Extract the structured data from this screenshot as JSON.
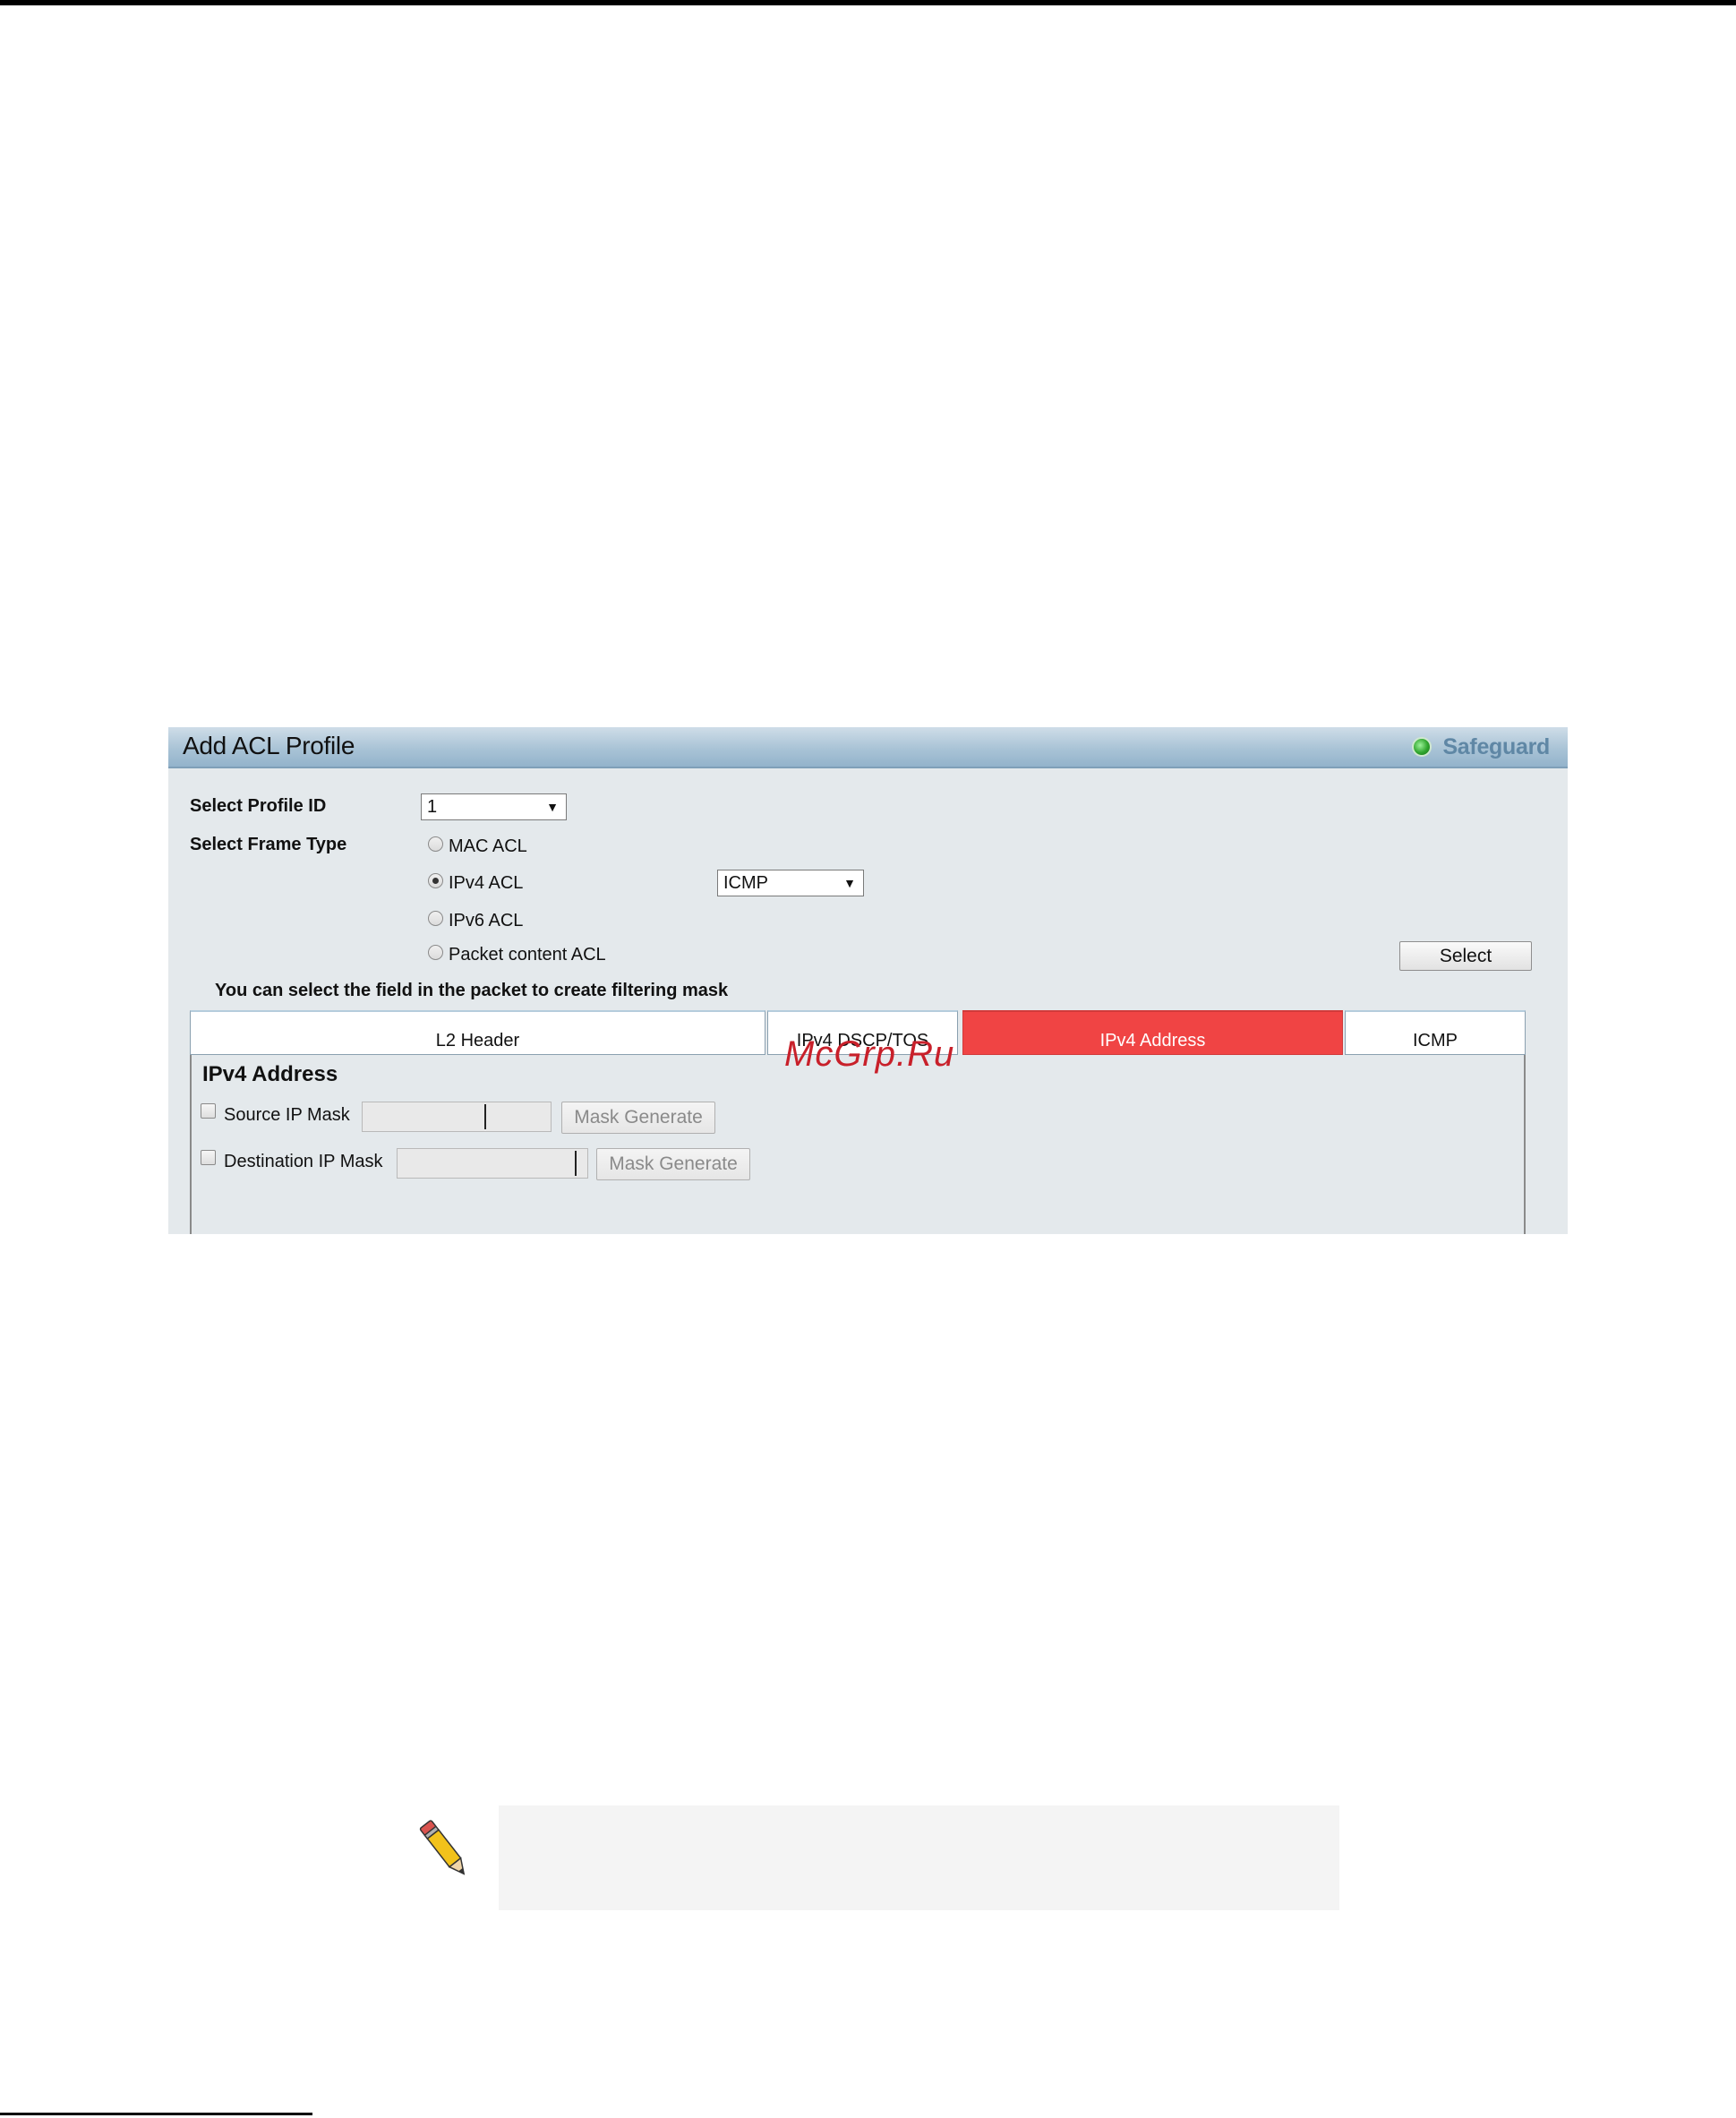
{
  "panel": {
    "title": "Add ACL Profile",
    "safeguard_label": "Safeguard",
    "safeguard_status_color": "#2fa52d"
  },
  "form": {
    "profile_id_label": "Select Profile ID",
    "profile_id_value": "1",
    "frame_type_label": "Select Frame Type",
    "frame_types": [
      {
        "label": "MAC ACL",
        "checked": false
      },
      {
        "label": "IPv4 ACL",
        "checked": true
      },
      {
        "label": "IPv6 ACL",
        "checked": false
      },
      {
        "label": "Packet content ACL",
        "checked": false
      }
    ],
    "ipv4_protocol_value": "ICMP",
    "select_button": "Select",
    "hint": "You can select the field in the packet to create filtering mask"
  },
  "tabs": [
    {
      "label": "L2 Header",
      "active": false
    },
    {
      "label": "IPv4 DSCP/TOS",
      "active": false
    },
    {
      "label": "IPv4 Address",
      "active": true
    },
    {
      "label": "ICMP",
      "active": false
    }
  ],
  "tab_content": {
    "section_title": "IPv4 Address",
    "source_label": "Source IP Mask",
    "destination_label": "Destination IP Mask",
    "mask_generate_label": "Mask Generate"
  },
  "watermark": "McGrp.Ru",
  "colors": {
    "active_tab": "#f04444",
    "header_gradient": "#a9c3d6",
    "panel_bg": "#e4e9ec"
  }
}
